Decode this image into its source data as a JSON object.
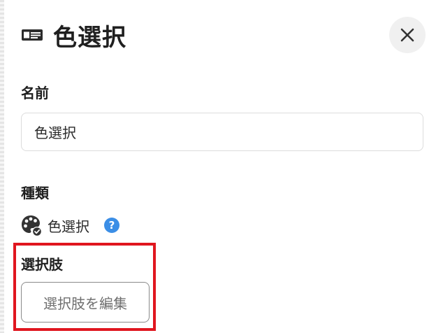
{
  "header": {
    "title": "色選択",
    "title_icon": "id-card-icon",
    "close_icon": "close-icon"
  },
  "form": {
    "name_label": "名前",
    "name_value": "色選択",
    "type_label": "種類",
    "type_value": "色選択",
    "type_icon": "palette-icon",
    "help_icon": "help-icon",
    "options_label": "選択肢",
    "edit_options_button": "選択肢を編集"
  },
  "colors": {
    "highlight": "#e0161f",
    "help": "#3b8ee6"
  }
}
